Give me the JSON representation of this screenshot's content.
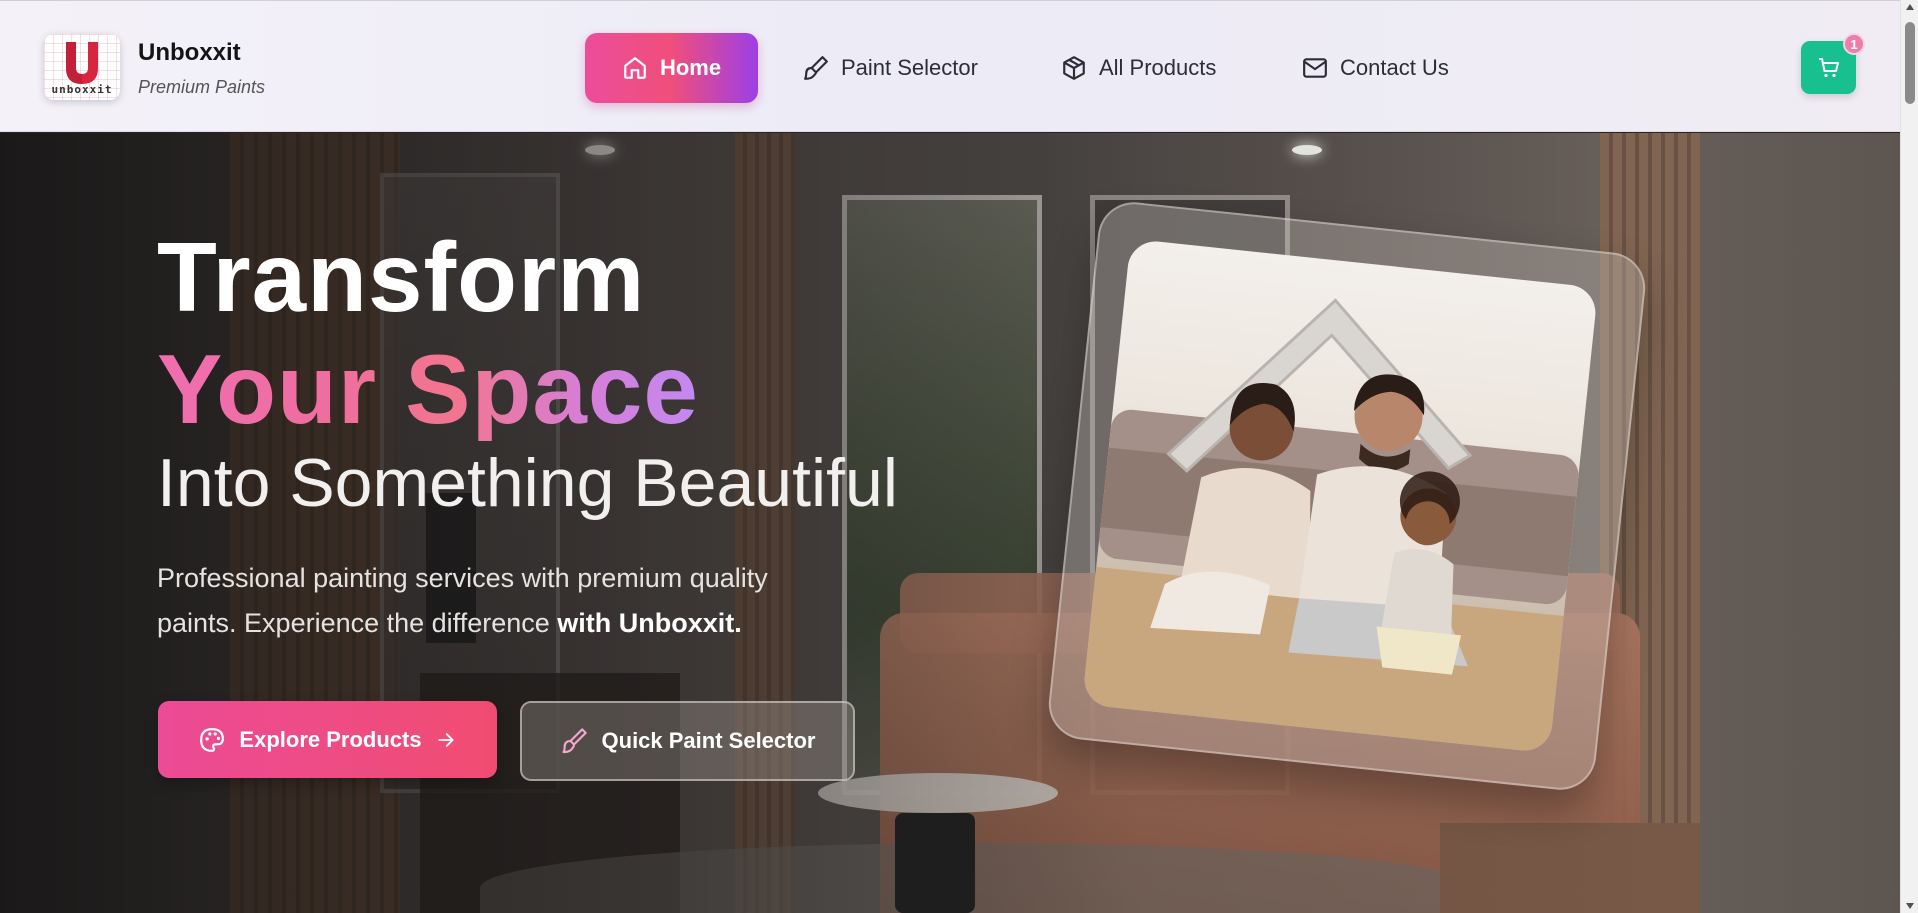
{
  "brand": {
    "logo_text": "unboxxit",
    "name": "Unboxxit",
    "tagline": "Premium Paints"
  },
  "nav": {
    "items": [
      {
        "label": "Home",
        "icon": "home-icon",
        "active": true
      },
      {
        "label": "Paint Selector",
        "icon": "paint-brush-icon",
        "active": false
      },
      {
        "label": "All Products",
        "icon": "box-icon",
        "active": false
      },
      {
        "label": "Contact Us",
        "icon": "mail-icon",
        "active": false
      }
    ],
    "cart": {
      "icon": "cart-icon",
      "count": "1"
    }
  },
  "hero": {
    "title_line1": "Transform",
    "title_line2": "Your Space",
    "title_line3": "Into Something Beautiful",
    "description": "Professional painting services with premium quality paints. Experience the difference",
    "description_bold": "with Unboxxit.",
    "primary_button": "Explore Products",
    "secondary_button": "Quick Paint Selector"
  },
  "colors": {
    "accent_pink": "#ec4b96",
    "accent_purple": "#9d3fe6",
    "cart_green": "#18bf8f"
  }
}
